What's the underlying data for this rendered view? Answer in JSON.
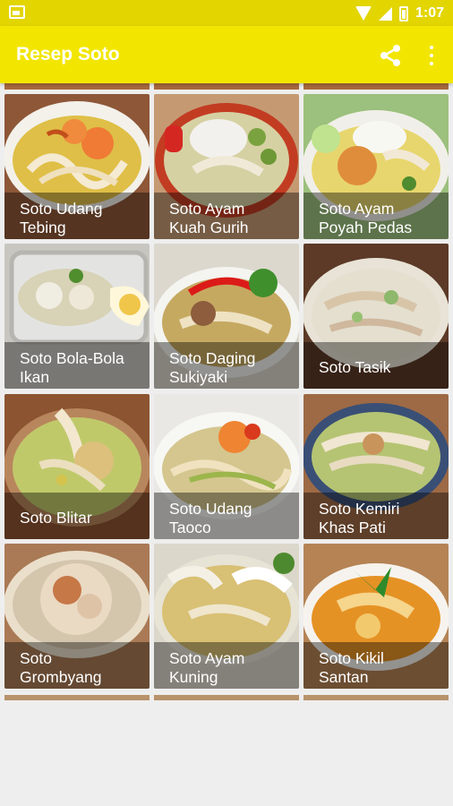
{
  "status_bar": {
    "time": "1:07"
  },
  "toolbar": {
    "title": "Resep Soto"
  },
  "theme": {
    "status_bar_color": "#e2d500",
    "toolbar_color": "#f2e600",
    "background": "#eeeeee"
  },
  "recipes": [
    {
      "name": "Soto Udang\nTebing"
    },
    {
      "name": "Soto Ayam\nKuah Gurih"
    },
    {
      "name": "Soto Ayam\nPoyah Pedas"
    },
    {
      "name": "Soto Bola-Bola\nIkan"
    },
    {
      "name": "Soto Daging\nSukiyaki"
    },
    {
      "name": "Soto Tasik"
    },
    {
      "name": "Soto Blitar"
    },
    {
      "name": "Soto Udang\nTaoco"
    },
    {
      "name": "Soto Kemiri\nKhas Pati"
    },
    {
      "name": "Soto\nGrombyang"
    },
    {
      "name": "Soto Ayam\nKuning"
    },
    {
      "name": "Soto Kikil\nSantan"
    }
  ]
}
